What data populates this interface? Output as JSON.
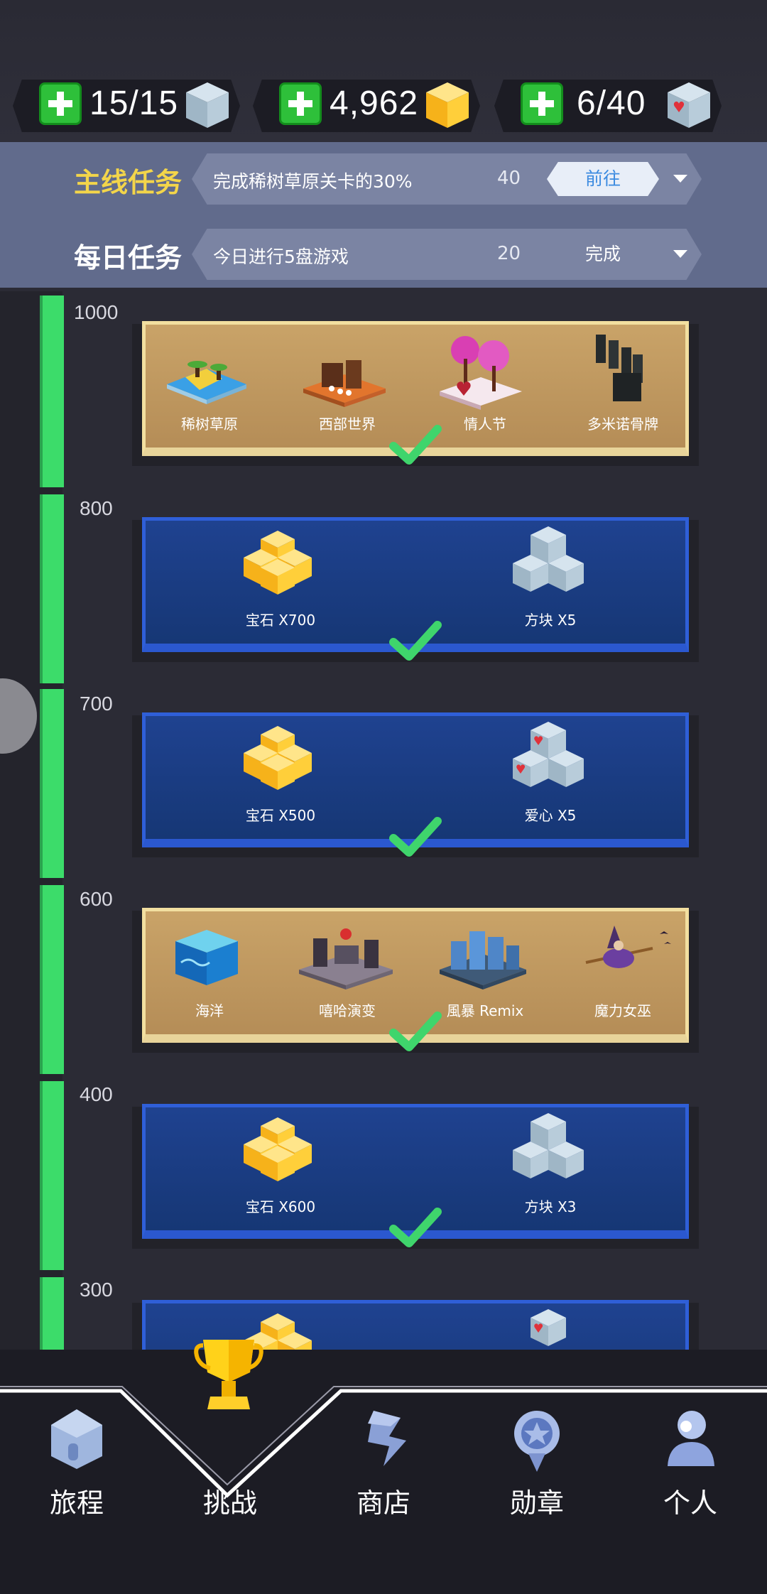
{
  "resources": [
    {
      "value": "15/15",
      "icon": "ice-cube-icon"
    },
    {
      "value": "4,962",
      "icon": "gem-icon"
    },
    {
      "value": "6/40",
      "icon": "heart-cube-icon"
    }
  ],
  "tasks": {
    "main": {
      "title": "主线任务",
      "desc": "完成稀树草原关卡的30%",
      "points": "40",
      "action": "前往"
    },
    "daily": {
      "title": "每日任务",
      "desc": "今日进行5盘游戏",
      "points": "20",
      "action": "完成"
    }
  },
  "milestones": [
    "1000",
    "800",
    "700",
    "600",
    "400",
    "300"
  ],
  "cards": {
    "c1000": {
      "items": [
        "稀树草原",
        "西部世界",
        "情人节",
        "多米诺骨牌"
      ]
    },
    "c800": {
      "items": [
        "宝石 X700",
        "方块 X5"
      ]
    },
    "c700": {
      "items": [
        "宝石 X500",
        "爱心 X5"
      ]
    },
    "c600": {
      "items": [
        "海洋",
        "嘻哈演变",
        "風暴 Remix",
        "魔力女巫"
      ]
    },
    "c400": {
      "items": [
        "宝石 X600",
        "方块 X3"
      ]
    }
  },
  "nav": [
    {
      "label": "旅程",
      "icon": "house-icon"
    },
    {
      "label": "挑战",
      "icon": "trophy-icon"
    },
    {
      "label": "商店",
      "icon": "shop-icon"
    },
    {
      "label": "勋章",
      "icon": "medal-icon"
    },
    {
      "label": "个人",
      "icon": "person-icon"
    }
  ],
  "colors": {
    "accent_green": "#3cdc6a",
    "main_task_yellow": "#f3d54a",
    "card_blue": "#1f4290",
    "card_gold": "#c9a368"
  }
}
